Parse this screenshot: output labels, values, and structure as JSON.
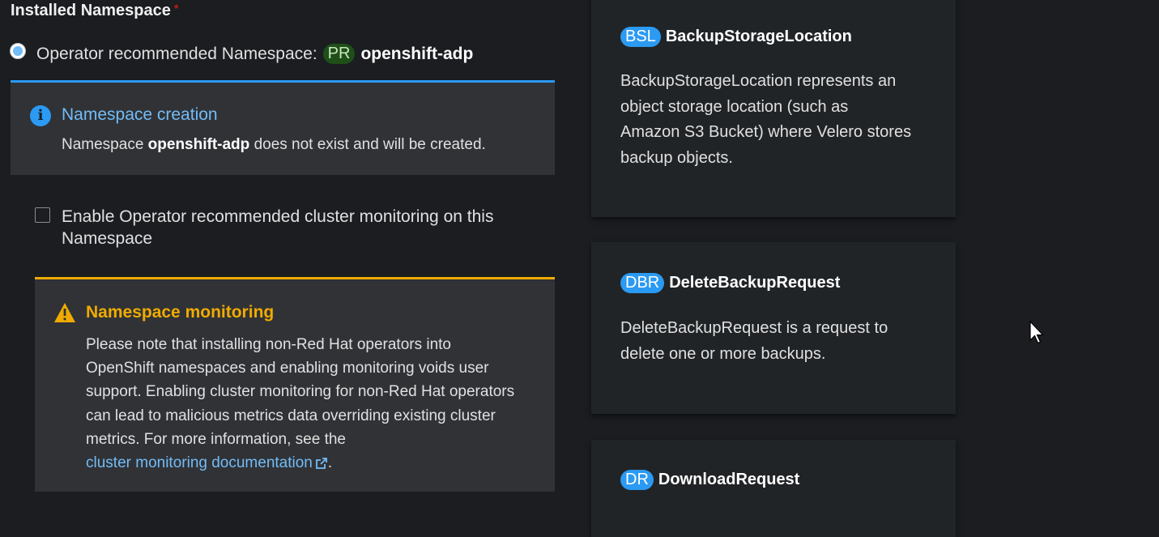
{
  "installed_namespace": {
    "label": "Installed Namespace",
    "required_marker": "*",
    "radio_label": "Operator recommended Namespace:",
    "badge": "PR",
    "namespace": "openshift-adp"
  },
  "info_alert": {
    "title": "Namespace creation",
    "body_prefix": "Namespace",
    "body_namespace": "openshift-adp",
    "body_suffix": "does not exist and will be created."
  },
  "monitoring_checkbox": {
    "label_line1": "Enable Operator recommended cluster monitoring on this",
    "label_line2": "Namespace",
    "checked": false
  },
  "warning_alert": {
    "title": "Namespace monitoring",
    "line1": "Please note that installing non-Red Hat operators into",
    "line2": "OpenShift namespaces and enabling monitoring voids user",
    "line3": "support. Enabling cluster monitoring for non-Red Hat operators",
    "line4": "can lead to malicious metrics data overriding existing cluster",
    "line5": "metrics. For more information, see the",
    "link": "cluster monitoring documentation",
    "link_suffix": "."
  },
  "cards": [
    {
      "badge": "BSL",
      "title": "BackupStorageLocation",
      "desc_line1": "BackupStorageLocation represents an",
      "desc_line2": "object storage location (such as",
      "desc_line3": "Amazon S3 Bucket) where Velero stores",
      "desc_line4": "backup objects."
    },
    {
      "badge": "DBR",
      "title": "DeleteBackupRequest",
      "desc_line1": "DeleteBackupRequest is a request to",
      "desc_line2": "delete one or more backups."
    },
    {
      "badge": "DR",
      "title": "DownloadRequest"
    }
  ],
  "colors": {
    "background": "#1b1d21",
    "info_accent": "#2b9af3",
    "warning_accent": "#f0ab00",
    "link": "#73bcf7",
    "pr_badge_bg": "#1e4f18"
  },
  "icons": [
    "info-icon",
    "warning-icon",
    "external-link-icon",
    "mouse-cursor-icon"
  ]
}
